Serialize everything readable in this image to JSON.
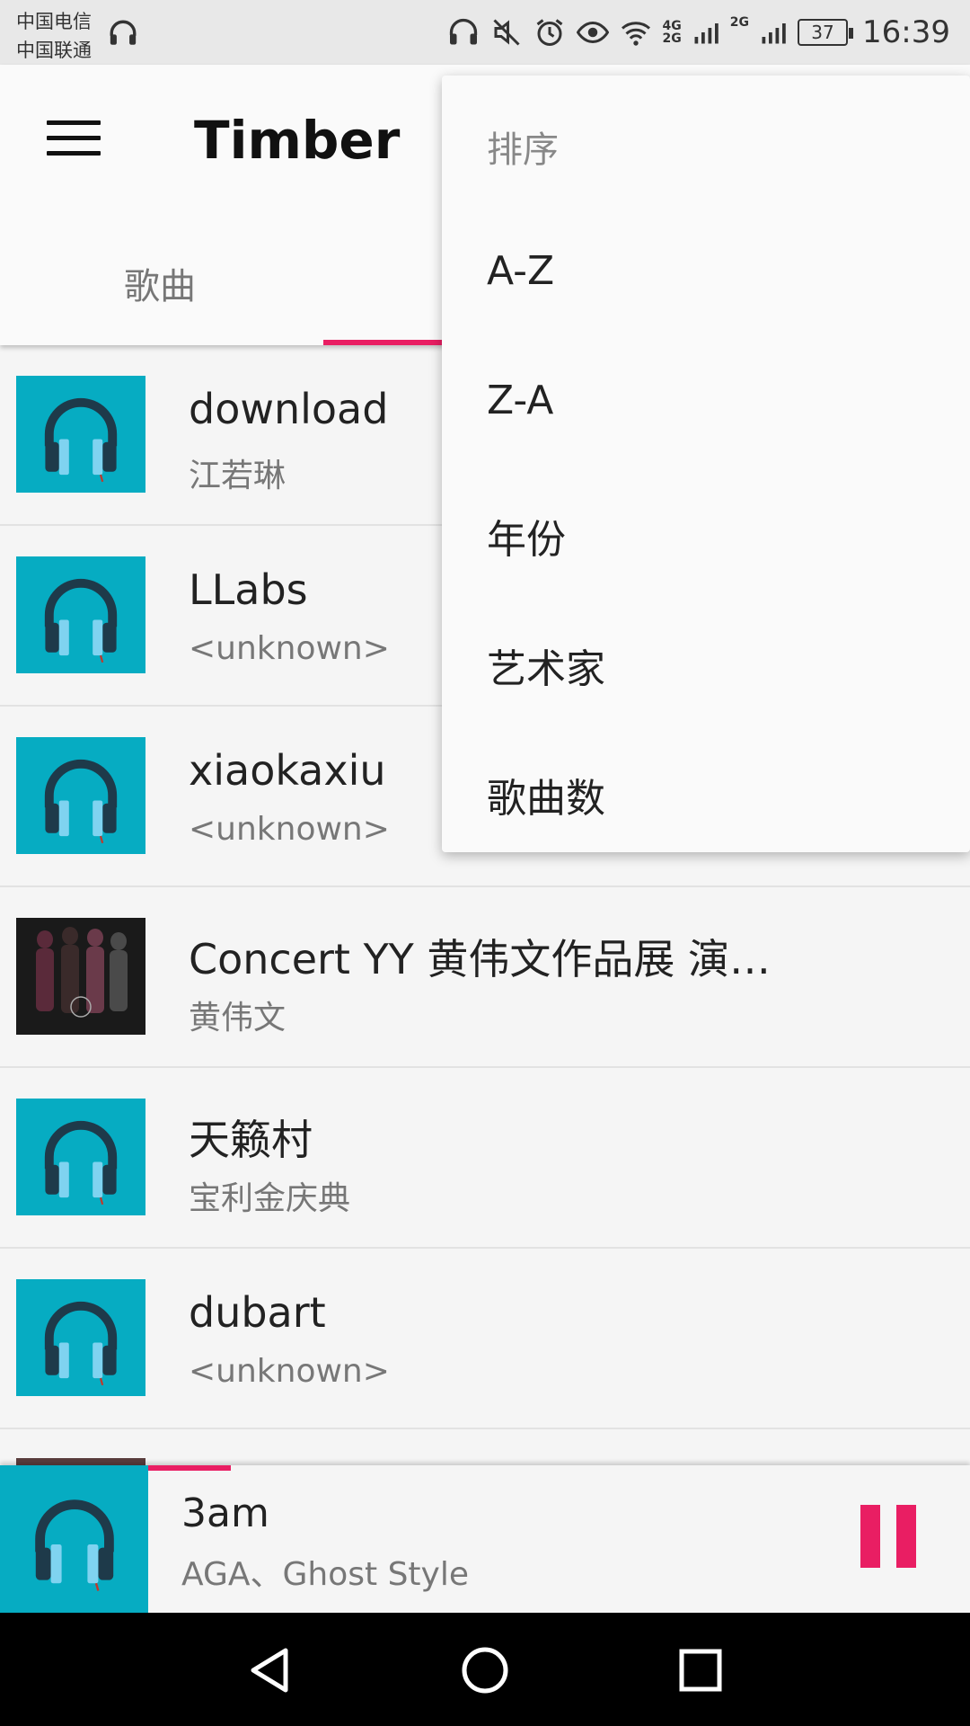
{
  "status_bar": {
    "carrier1": "中国电信",
    "carrier2": "中国联通",
    "net_top": "4G",
    "net_bottom": "2G",
    "net2": "2G",
    "battery": "37",
    "time": "16:39",
    "icons": [
      "headset-icon",
      "mute-icon",
      "alarm-icon",
      "eye-icon",
      "wifi-icon",
      "signal-icon",
      "signal-icon",
      "battery-icon"
    ]
  },
  "app_bar": {
    "title": "Timber",
    "tab_songs": "歌曲",
    "accent": "#e91e63"
  },
  "songs": [
    {
      "title": "download",
      "artist": "江若琳",
      "art": "headphones"
    },
    {
      "title": "LLabs",
      "artist": "<unknown>",
      "art": "headphones"
    },
    {
      "title": "xiaokaxiu",
      "artist": "<unknown>",
      "art": "headphones"
    },
    {
      "title": "Concert YY 黄伟文作品展 演…",
      "artist": "黄伟文",
      "art": "album-cover"
    },
    {
      "title": "天籁村",
      "artist": "宝利金庆典",
      "art": "headphones"
    },
    {
      "title": "dubart",
      "artist": "<unknown>",
      "art": "headphones"
    }
  ],
  "sort_menu": {
    "header": "排序",
    "items": [
      "A-Z",
      "Z-A",
      "年份",
      "艺术家",
      "歌曲数"
    ]
  },
  "now_playing": {
    "title": "3am",
    "artist": "AGA、Ghost Style",
    "progress": 0.1
  },
  "colors": {
    "art_bg": "#06acc2",
    "accent": "#e91e63"
  }
}
